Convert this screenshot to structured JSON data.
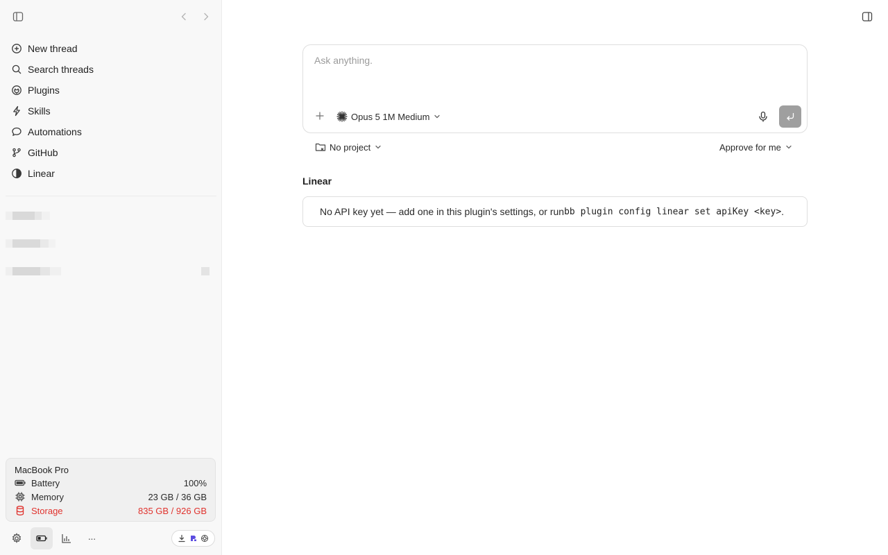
{
  "sidebar": {
    "nav": [
      {
        "label": "New thread",
        "icon": "plus-circle-icon"
      },
      {
        "label": "Search threads",
        "icon": "search-icon"
      },
      {
        "label": "Plugins",
        "icon": "plugin-icon"
      },
      {
        "label": "Skills",
        "icon": "lightning-icon"
      },
      {
        "label": "Automations",
        "icon": "chat-bubble-icon"
      },
      {
        "label": "GitHub",
        "icon": "git-branch-icon"
      },
      {
        "label": "Linear",
        "icon": "half-circle-icon"
      }
    ],
    "device": {
      "title": "MacBook Pro",
      "battery_label": "Battery",
      "battery_value": "100%",
      "memory_label": "Memory",
      "memory_value": "23 GB / 36 GB",
      "storage_label": "Storage",
      "storage_value": "835 GB / 926 GB"
    },
    "footer_more": "···"
  },
  "composer": {
    "placeholder": "Ask anything.",
    "model_label": "Opus 5 1M Medium"
  },
  "project_label": "No project",
  "approval_label": "Approve for me",
  "linear": {
    "title": "Linear",
    "notice_text": "No API key yet — add one in this plugin's settings, or run ",
    "notice_command": "bb plugin config linear set apiKey <key>",
    "notice_end": "."
  },
  "colors": {
    "warning": "#e0322d",
    "send_button": "#9f9f9f",
    "sidebar_bg": "#f8f8f8"
  }
}
